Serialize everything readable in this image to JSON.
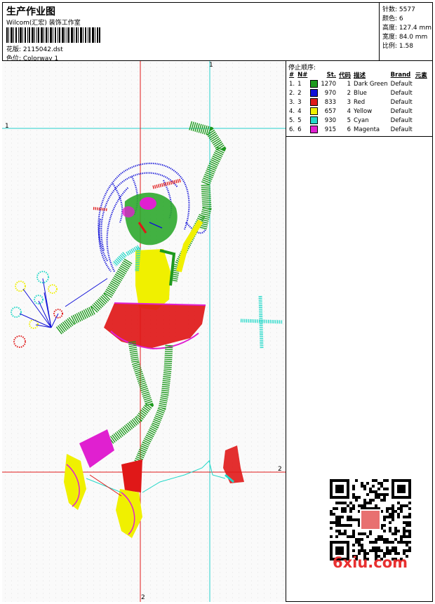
{
  "header": {
    "title": "生产作业图",
    "company": "Wilcom(汇宏) 装饰工作室",
    "design_label": "花版: 2115042.dst",
    "colorway_label": "色位: Colorway 1"
  },
  "stats": {
    "stitches": "针数: 5577",
    "colors": "颜色: 6",
    "height": "高度: 127.4 mm",
    "width": "宽度: 84.0 mm",
    "ratio": "比例: 1.58"
  },
  "stop_sequence": {
    "title": "停止顺序:",
    "headers": {
      "idx": "#",
      "no": "N#",
      "st": "St.",
      "code": "代码",
      "desc": "描述",
      "brand": "Brand",
      "element": "元素"
    },
    "rows": [
      {
        "idx": "1.",
        "no": "1",
        "color": "#1e9a1e",
        "st": "1270",
        "code": "1",
        "desc": "Dark Green",
        "brand": "Default"
      },
      {
        "idx": "2.",
        "no": "2",
        "color": "#1010d8",
        "st": "970",
        "code": "2",
        "desc": "Blue",
        "brand": "Default"
      },
      {
        "idx": "3.",
        "no": "3",
        "color": "#e01818",
        "st": "833",
        "code": "3",
        "desc": "Red",
        "brand": "Default"
      },
      {
        "idx": "4.",
        "no": "4",
        "color": "#f0f000",
        "st": "657",
        "code": "4",
        "desc": "Yellow",
        "brand": "Default"
      },
      {
        "idx": "5.",
        "no": "5",
        "color": "#22d8c8",
        "st": "930",
        "code": "5",
        "desc": "Cyan",
        "brand": "Default"
      },
      {
        "idx": "6.",
        "no": "6",
        "color": "#e020d0",
        "st": "915",
        "code": "6",
        "desc": "Magenta",
        "brand": "Default"
      }
    ]
  },
  "canvas": {
    "guide_labels": {
      "cyan_v": "1",
      "cyan_h": "1",
      "red_h": "2",
      "red_v": "2"
    }
  },
  "watermark": {
    "text": "6xiu.com",
    "color": "#e83030"
  }
}
